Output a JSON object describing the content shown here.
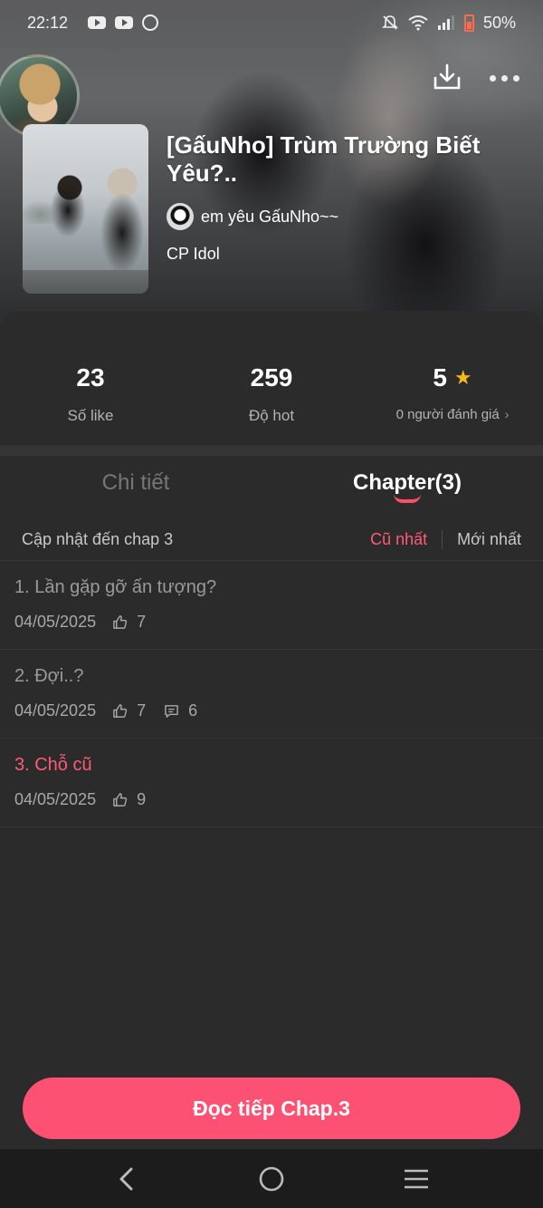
{
  "status_bar": {
    "time": "22:12",
    "battery": "50%",
    "icons": [
      "youtube-icon",
      "youtube-icon",
      "messenger-icon",
      "mute-icon",
      "wifi-icon",
      "signal-icon",
      "battery-icon"
    ]
  },
  "header": {
    "title": "[GấuNho] Trùm Trường Biết Yêu?..",
    "author": "em yêu GấuNho~~",
    "category": "CP Idol",
    "actions": [
      "download-icon",
      "more-icon"
    ]
  },
  "stats": [
    {
      "value": "23",
      "label": "Số like"
    },
    {
      "value": "259",
      "label": "Độ hot"
    },
    {
      "value": "5",
      "label": "0 người đánh giá"
    }
  ],
  "tabs": [
    {
      "label": "Chi tiết",
      "active": false
    },
    {
      "label": "Chapter(3)",
      "active": true
    }
  ],
  "chapter_list": {
    "update_text": "Cập nhật đến chap 3",
    "sort_old": "Cũ nhất",
    "sort_new": "Mới nhất",
    "items": [
      {
        "title": "1. Lần gặp gỡ ấn tượng?",
        "date": "04/05/2025",
        "likes": "7",
        "comments": null,
        "current": false
      },
      {
        "title": "2. Đợi..?",
        "date": "04/05/2025",
        "likes": "7",
        "comments": "6",
        "current": false
      },
      {
        "title": "3. Chỗ cũ",
        "date": "04/05/2025",
        "likes": "9",
        "comments": null,
        "current": true
      }
    ]
  },
  "footer": {
    "read_button": "Đọc tiếp Chap.3"
  },
  "colors": {
    "accent": "#fd5173",
    "star": "#f5b81a",
    "background": "#2b2b2b"
  }
}
